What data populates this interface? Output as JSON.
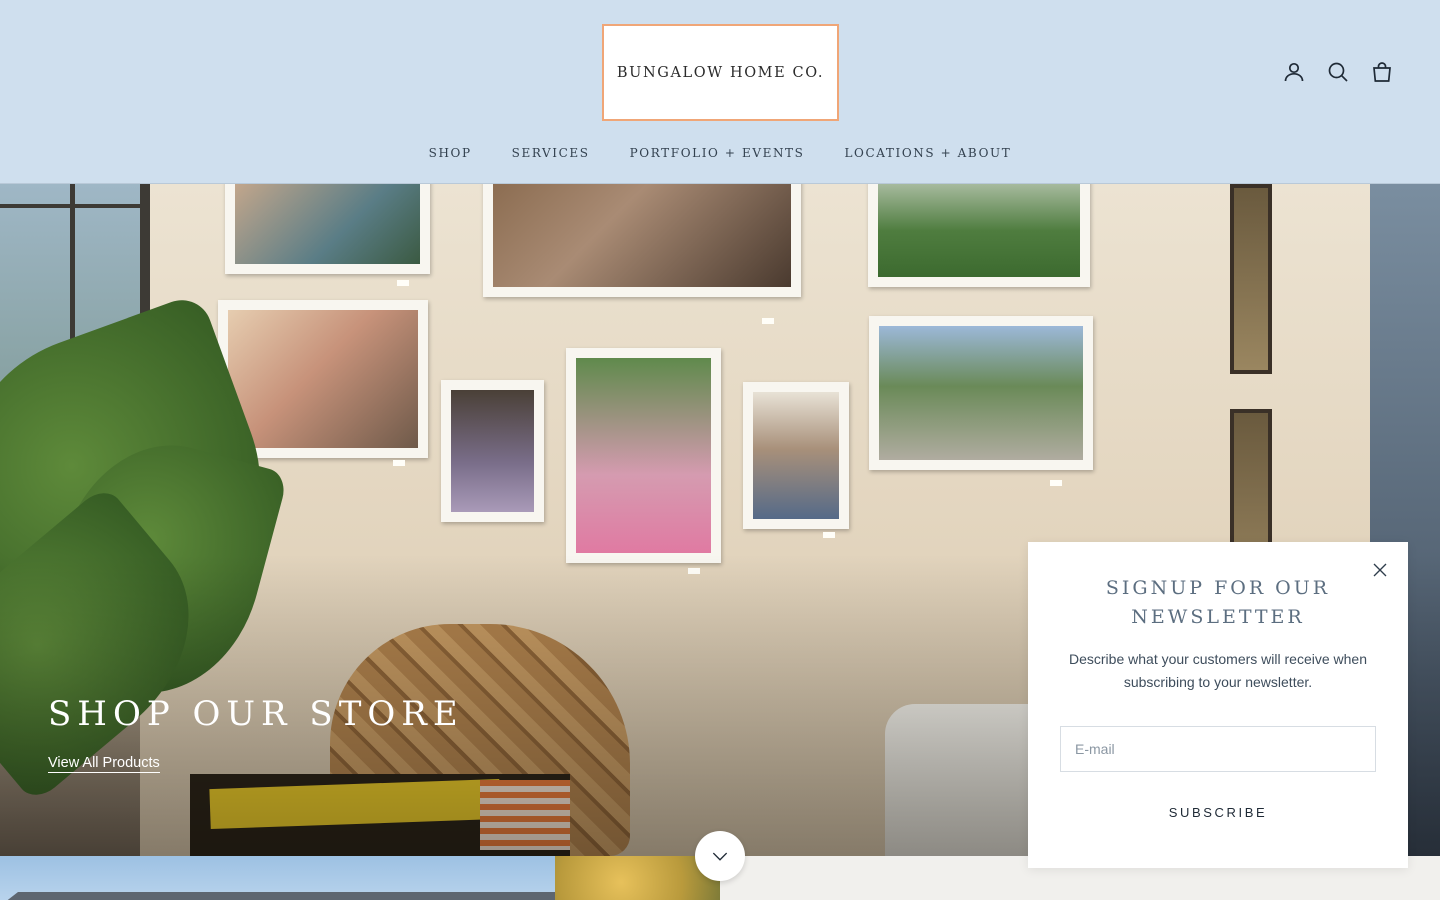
{
  "header": {
    "logo_text": "BUNGALOW HOME CO.",
    "icons": [
      "account-icon",
      "search-icon",
      "cart-icon"
    ],
    "nav": [
      {
        "label": "SHOP"
      },
      {
        "label": "SERVICES"
      },
      {
        "label": "PORTFOLIO + EVENTS"
      },
      {
        "label": "LOCATIONS + ABOUT"
      }
    ]
  },
  "hero": {
    "title": "SHOP OUR STORE",
    "link_label": "View All Products"
  },
  "newsletter": {
    "title": "SIGNUP FOR OUR NEWSLETTER",
    "description": "Describe what your customers will receive when subscribing to your newsletter.",
    "email_placeholder": "E-mail",
    "subscribe_label": "SUBSCRIBE"
  },
  "colors": {
    "header_bg": "#cfdfee",
    "logo_border": "#f0a677",
    "newsletter_title": "#5c6e80",
    "bottom_bg": "#f1f0ed"
  }
}
